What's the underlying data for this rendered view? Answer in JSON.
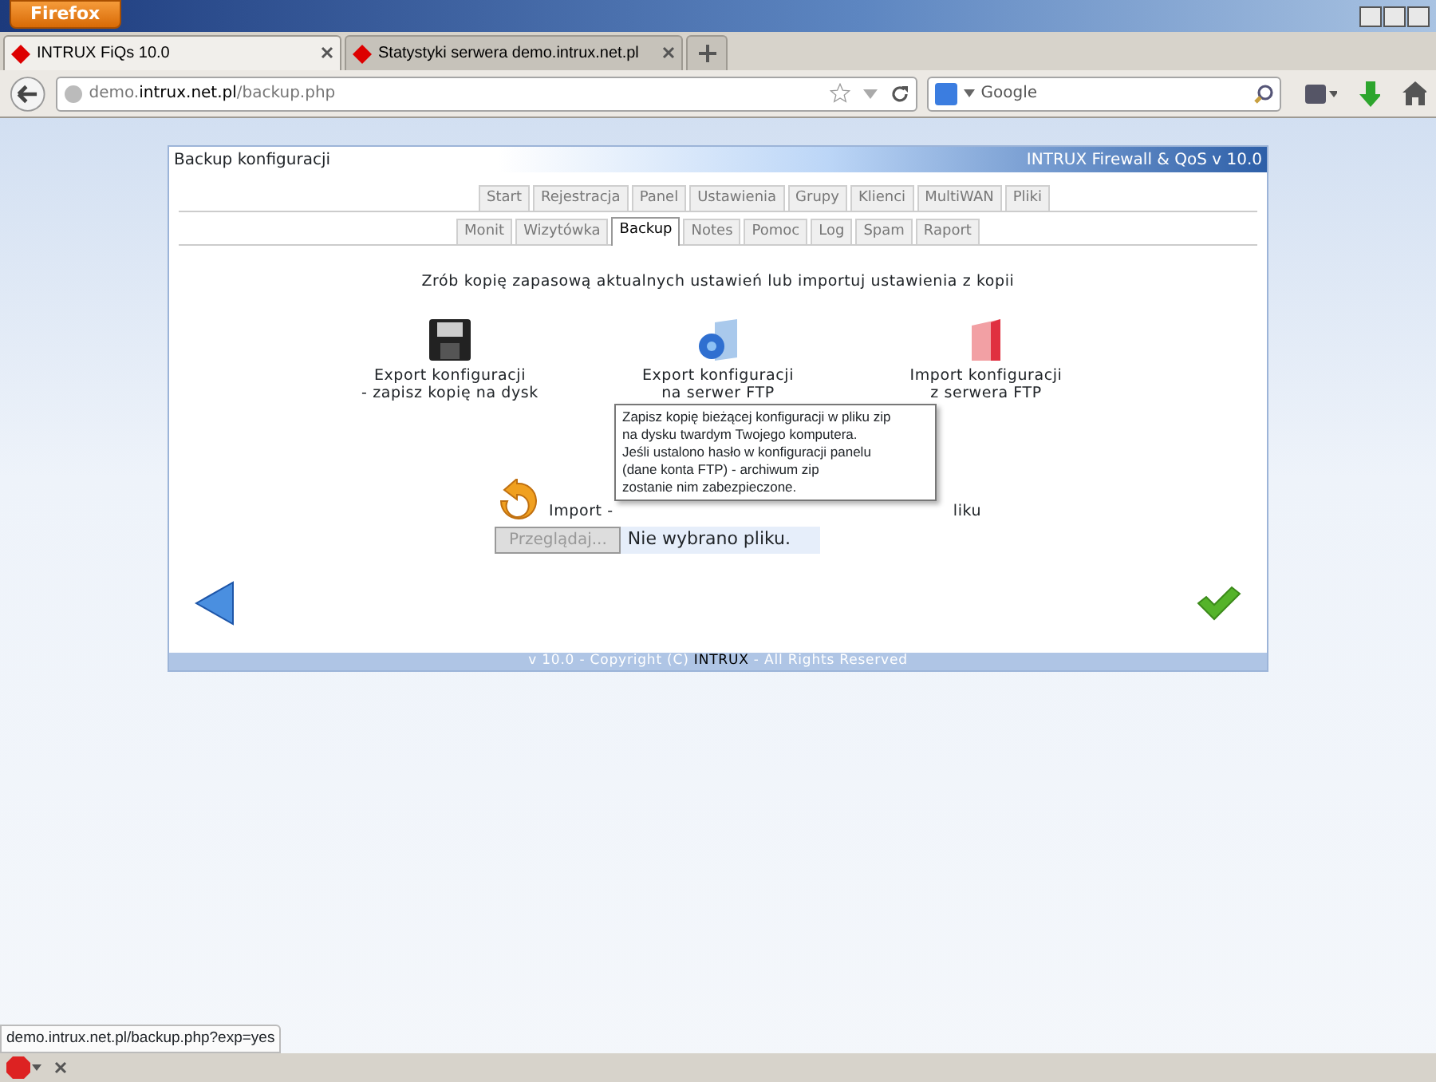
{
  "browser": {
    "menu_button": "Firefox",
    "tabs": [
      {
        "title": "INTRUX FiQs 10.0",
        "selected": true
      },
      {
        "title": "Statystyki serwera demo.intrux.net.pl",
        "selected": false
      }
    ],
    "address": {
      "prefix": "demo.",
      "host": "intrux.net.pl",
      "path": "/backup.php"
    },
    "search": {
      "placeholder": "Google"
    }
  },
  "panel": {
    "title": "Backup konfiguracji",
    "brand": "INTRUX Firewall & QoS v 10.0",
    "tab_rows": [
      [
        {
          "label": "Start",
          "selected": false
        },
        {
          "label": "Rejestracja",
          "selected": false
        },
        {
          "label": "Panel",
          "selected": false
        },
        {
          "label": "Ustawienia",
          "selected": false
        },
        {
          "label": "Grupy",
          "selected": false
        },
        {
          "label": "Klienci",
          "selected": false
        },
        {
          "label": "MultiWAN",
          "selected": false
        },
        {
          "label": "Pliki",
          "selected": false
        }
      ],
      [
        {
          "label": "Monit",
          "selected": false
        },
        {
          "label": "Wizytówka",
          "selected": false
        },
        {
          "label": "Backup",
          "selected": true
        },
        {
          "label": "Notes",
          "selected": false
        },
        {
          "label": "Pomoc",
          "selected": false
        },
        {
          "label": "Log",
          "selected": false
        },
        {
          "label": "Spam",
          "selected": false
        },
        {
          "label": "Raport",
          "selected": false
        }
      ]
    ],
    "intro": "Zrób kopię zapasową aktualnych ustawień lub importuj ustawienia z kopii",
    "actions": [
      {
        "kind": "disk",
        "lines": [
          "Export konfiguracji",
          "- zapisz kopię na dysk"
        ]
      },
      {
        "kind": "ftp-export",
        "lines": [
          "Export konfiguracji",
          "na serwer FTP"
        ]
      },
      {
        "kind": "ftp-import",
        "lines": [
          "Import konfiguracji",
          "z serwera FTP"
        ]
      }
    ],
    "tooltip": [
      "Zapisz kopię bieżącej konfiguracji w pliku zip",
      "na dysku twardym Twojego komputera.",
      "Jeśli ustalono hasło w konfiguracji panelu",
      "(dane konta FTP) - archiwum zip",
      "zostanie nim zabezpieczone."
    ],
    "import": {
      "label": "Import -",
      "tail": "liku",
      "browse_button": "Przeglądaj...",
      "browse_disabled": true,
      "file_status": "Nie wybrano pliku."
    },
    "footer": {
      "before": "v 10.0 - Copyright (C) ",
      "brand": "INTRUX",
      "after": " - All Rights Reserved"
    }
  },
  "status_link": "demo.intrux.net.pl/backup.php?exp=yes"
}
